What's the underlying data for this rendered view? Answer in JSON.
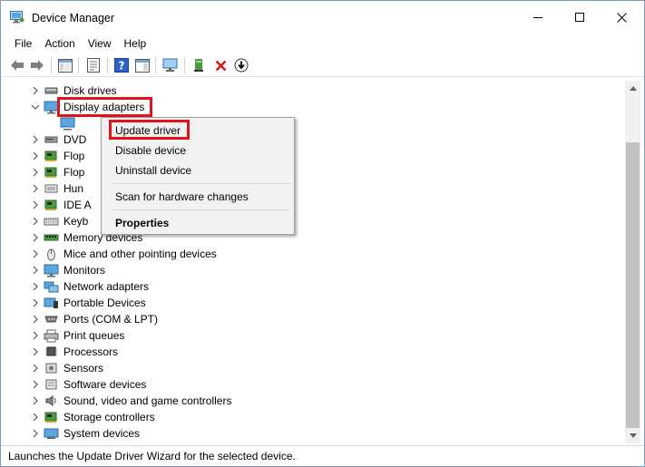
{
  "window": {
    "title": "Device Manager"
  },
  "menubar": {
    "items": [
      "File",
      "Action",
      "View",
      "Help"
    ]
  },
  "tree": {
    "items": [
      {
        "label": "Disk drives",
        "expanded": false,
        "icon": "disk-drive-icon"
      },
      {
        "label": "Display adapters",
        "expanded": true,
        "icon": "monitor-icon"
      },
      {
        "label": "",
        "child": true,
        "icon": "display-card-icon"
      },
      {
        "label": "DVD",
        "expanded": false,
        "icon": "dvd-icon"
      },
      {
        "label": "Flop",
        "expanded": false,
        "icon": "floppy-controller-icon"
      },
      {
        "label": "Flop",
        "expanded": false,
        "icon": "floppy-drive-icon"
      },
      {
        "label": "Hun",
        "expanded": false,
        "icon": "hid-icon"
      },
      {
        "label": "IDE A",
        "expanded": false,
        "icon": "ide-icon"
      },
      {
        "label": "Keyb",
        "expanded": false,
        "icon": "keyboard-icon"
      },
      {
        "label": "Memory devices",
        "expanded": false,
        "icon": "memory-icon"
      },
      {
        "label": "Mice and other pointing devices",
        "expanded": false,
        "icon": "mouse-icon"
      },
      {
        "label": "Monitors",
        "expanded": false,
        "icon": "monitor-icon"
      },
      {
        "label": "Network adapters",
        "expanded": false,
        "icon": "network-icon"
      },
      {
        "label": "Portable Devices",
        "expanded": false,
        "icon": "portable-device-icon"
      },
      {
        "label": "Ports (COM & LPT)",
        "expanded": false,
        "icon": "port-icon"
      },
      {
        "label": "Print queues",
        "expanded": false,
        "icon": "printer-icon"
      },
      {
        "label": "Processors",
        "expanded": false,
        "icon": "processor-icon"
      },
      {
        "label": "Sensors",
        "expanded": false,
        "icon": "sensor-icon"
      },
      {
        "label": "Software devices",
        "expanded": false,
        "icon": "software-device-icon"
      },
      {
        "label": "Sound, video and game controllers",
        "expanded": false,
        "icon": "speaker-icon"
      },
      {
        "label": "Storage controllers",
        "expanded": false,
        "icon": "storage-controller-icon"
      },
      {
        "label": "System devices",
        "expanded": false,
        "icon": "system-device-icon"
      }
    ]
  },
  "context_menu": {
    "update_driver": "Update driver",
    "disable_device": "Disable device",
    "uninstall_device": "Uninstall device",
    "scan_hardware": "Scan for hardware changes",
    "properties": "Properties"
  },
  "statusbar": {
    "text": "Launches the Update Driver Wizard for the selected device."
  },
  "colors": {
    "highlight": "#e0121b",
    "menu_bg": "#f2f2f2",
    "scroll_thumb": "#c2c2c2"
  }
}
